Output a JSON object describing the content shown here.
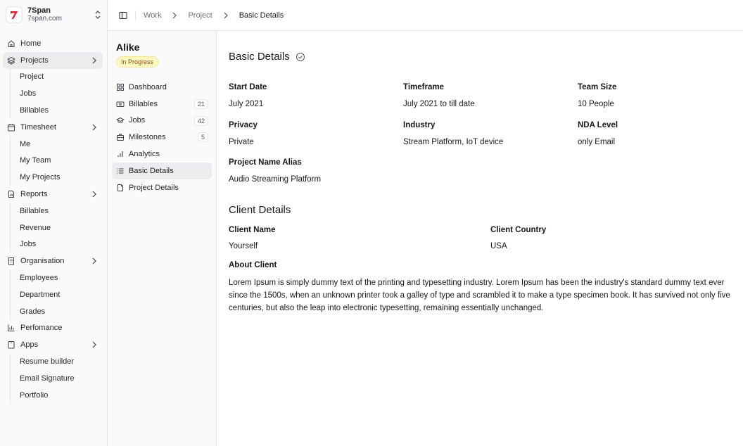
{
  "org": {
    "name": "7Span",
    "domain": "7span.com",
    "brand_color": "#e11d2e"
  },
  "sidebar": {
    "home": "Home",
    "projects": {
      "label": "Projects",
      "children": [
        "Project",
        "Jobs",
        "Billables"
      ]
    },
    "timesheet": {
      "label": "Timesheet",
      "children": [
        "Me",
        "My Team",
        "My Projects"
      ]
    },
    "reports": {
      "label": "Reports",
      "children": [
        "Billables",
        "Revenue",
        "Jobs"
      ]
    },
    "organisation": {
      "label": "Organisation",
      "children": [
        "Employees",
        "Department",
        "Grades"
      ]
    },
    "perfomance": "Perfomance",
    "apps": {
      "label": "Apps",
      "children": [
        "Resume builder",
        "Email Signature",
        "Portfolio"
      ]
    }
  },
  "breadcrumb": [
    "Work",
    "Project",
    "Basic Details"
  ],
  "project": {
    "name": "Alike",
    "status": "In Progress",
    "nav": [
      {
        "label": "Dashboard",
        "icon": "dashboard-icon"
      },
      {
        "label": "Billables",
        "icon": "billables-icon",
        "count": "21"
      },
      {
        "label": "Jobs",
        "icon": "jobs-icon",
        "count": "42"
      },
      {
        "label": "Milestones",
        "icon": "milestones-icon",
        "count": "5"
      },
      {
        "label": "Analytics",
        "icon": "analytics-icon"
      },
      {
        "label": "Basic Details",
        "icon": "list-icon"
      },
      {
        "label": "Project Details",
        "icon": "document-icon"
      }
    ]
  },
  "basic_details": {
    "title": "Basic Details",
    "fields": {
      "start_date": {
        "label": "Start Date",
        "value": "July 2021"
      },
      "timeframe": {
        "label": "Timeframe",
        "value": "July 2021 to till date"
      },
      "team_size": {
        "label": "Team Size",
        "value": "10 People"
      },
      "privacy": {
        "label": "Privacy",
        "value": "Private"
      },
      "industry": {
        "label": "Industry",
        "value": "Stream Platform, IoT device"
      },
      "nda_level": {
        "label": "NDA Level",
        "value": "only Email"
      },
      "alias": {
        "label": "Project Name Alias",
        "value": "Audio Streaming Platform"
      }
    }
  },
  "client_details": {
    "title": "Client Details",
    "client_name": {
      "label": "Client Name",
      "value": "Yourself"
    },
    "client_country": {
      "label": "Client Country",
      "value": "USA"
    },
    "about": {
      "label": "About Client",
      "value": "Lorem Ipsum is simply dummy text of the printing and typesetting industry. Lorem Ipsum has been the industry's standard dummy text ever since the 1500s, when an unknown printer took a galley of type and scrambled it to make a type specimen book. It has survived not only five centuries, but also the leap into electronic typesetting, remaining essentially unchanged."
    }
  }
}
